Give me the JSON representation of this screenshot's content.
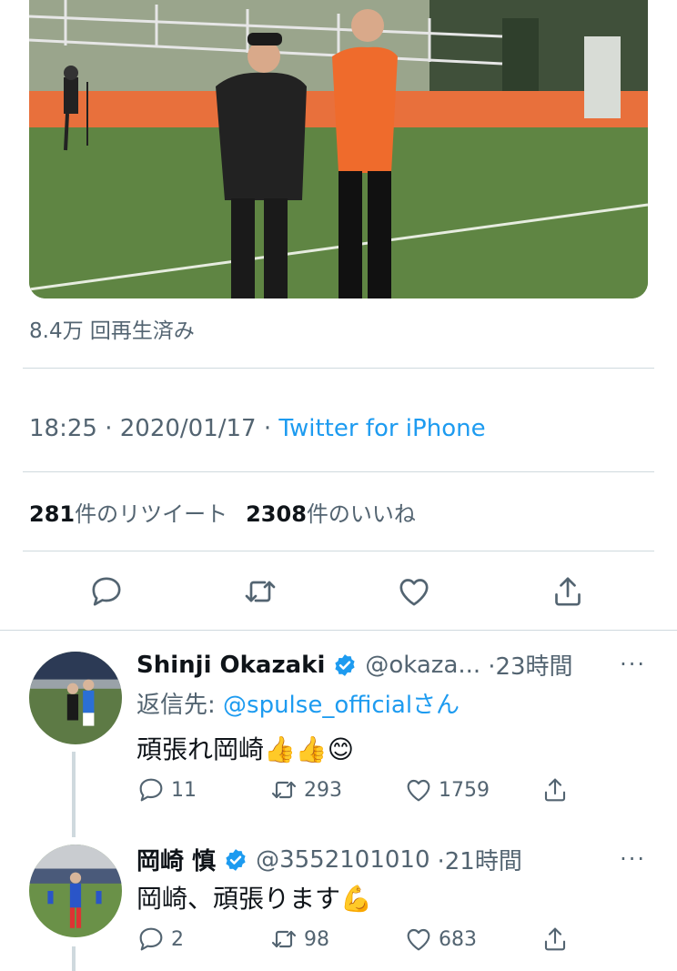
{
  "tweet": {
    "view_count": "8.4万 回再生済み",
    "time": "18:25",
    "date": "2020/01/17",
    "source": "Twitter for iPhone",
    "retweets_count": "281",
    "retweets_label": "件のリツイート",
    "likes_count": "2308",
    "likes_label": "件のいいね",
    "meta_separator": " · "
  },
  "actions": {
    "reply_icon": "speech-bubble",
    "retweet_icon": "retweet-arrows",
    "like_icon": "heart",
    "share_icon": "share-upload"
  },
  "replies": [
    {
      "name": "Shinji Okazaki",
      "handle": "@okaza...",
      "time": "·23時間",
      "reply_to_prefix": "返信先: ",
      "reply_to_mention": "@spulse_officialさん",
      "text": "頑張れ岡崎👍👍😊",
      "reply_count": "11",
      "retweet_count": "293",
      "like_count": "1759",
      "more": "···"
    },
    {
      "name": "岡崎 慎",
      "handle": "@3552101010",
      "time": "·21時間",
      "text": "岡崎、頑張ります💪",
      "reply_count": "2",
      "retweet_count": "98",
      "like_count": "683",
      "more": "···"
    }
  ],
  "colors": {
    "accent": "#1d9bf0",
    "secondary_text": "#536471",
    "divider": "#cfd9de"
  }
}
